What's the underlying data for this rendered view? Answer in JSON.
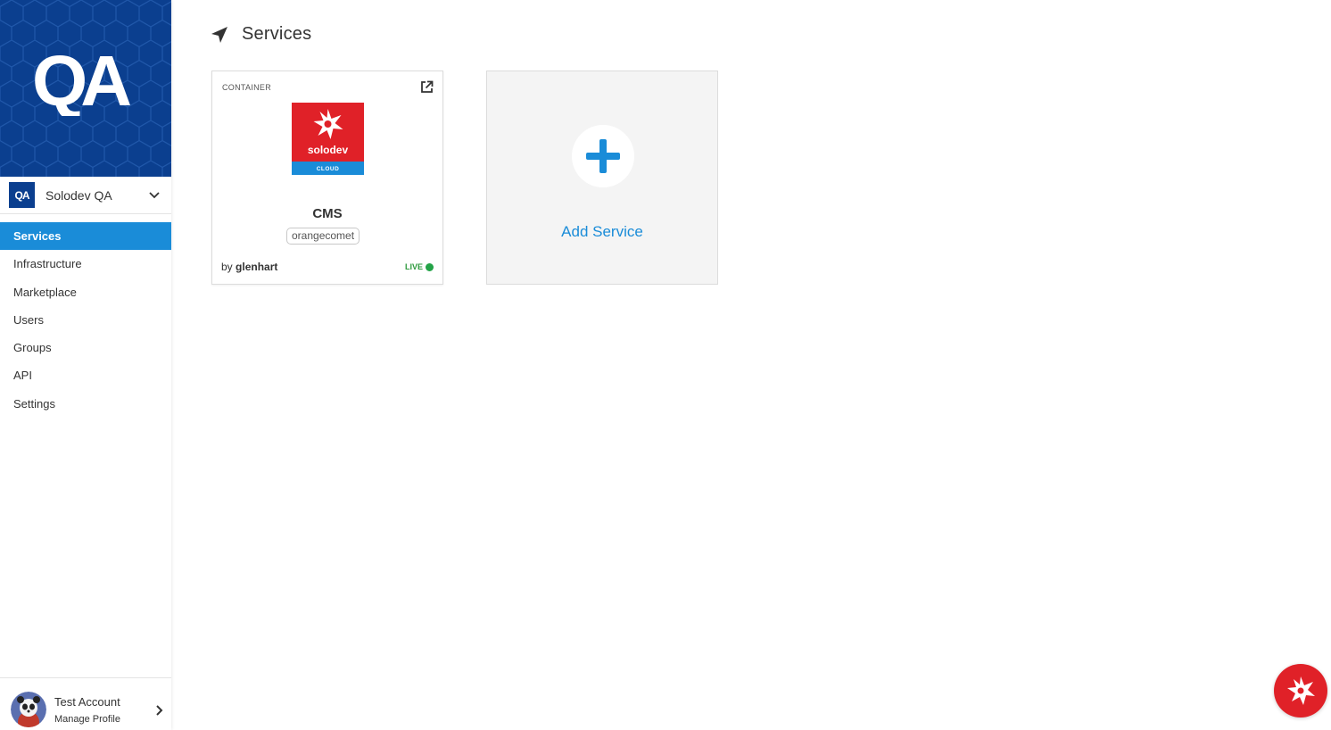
{
  "brand": {
    "logo_text": "QA",
    "color": "#0b3f8f"
  },
  "org_switcher": {
    "badge": "QA",
    "name": "Solodev QA"
  },
  "sidebar": {
    "items": [
      {
        "label": "Services",
        "active": true
      },
      {
        "label": "Infrastructure"
      },
      {
        "label": "Marketplace"
      },
      {
        "label": "Users"
      },
      {
        "label": "Groups"
      },
      {
        "label": "API"
      },
      {
        "label": "Settings"
      }
    ]
  },
  "profile": {
    "name": "Test Account",
    "action": "Manage Profile"
  },
  "page": {
    "title": "Services",
    "icon": "location-arrow-icon"
  },
  "services": [
    {
      "type": "CONTAINER",
      "logo_text": "solodev",
      "logo_subtext": "CLOUD",
      "name": "CMS",
      "tag": "orangecomet",
      "by_prefix": "by",
      "owner": "glenhart",
      "status": "LIVE"
    }
  ],
  "add_service": {
    "label": "Add Service"
  },
  "colors": {
    "accent": "#1a8cd8",
    "live": "#23a347",
    "brand_red": "#e02128"
  }
}
